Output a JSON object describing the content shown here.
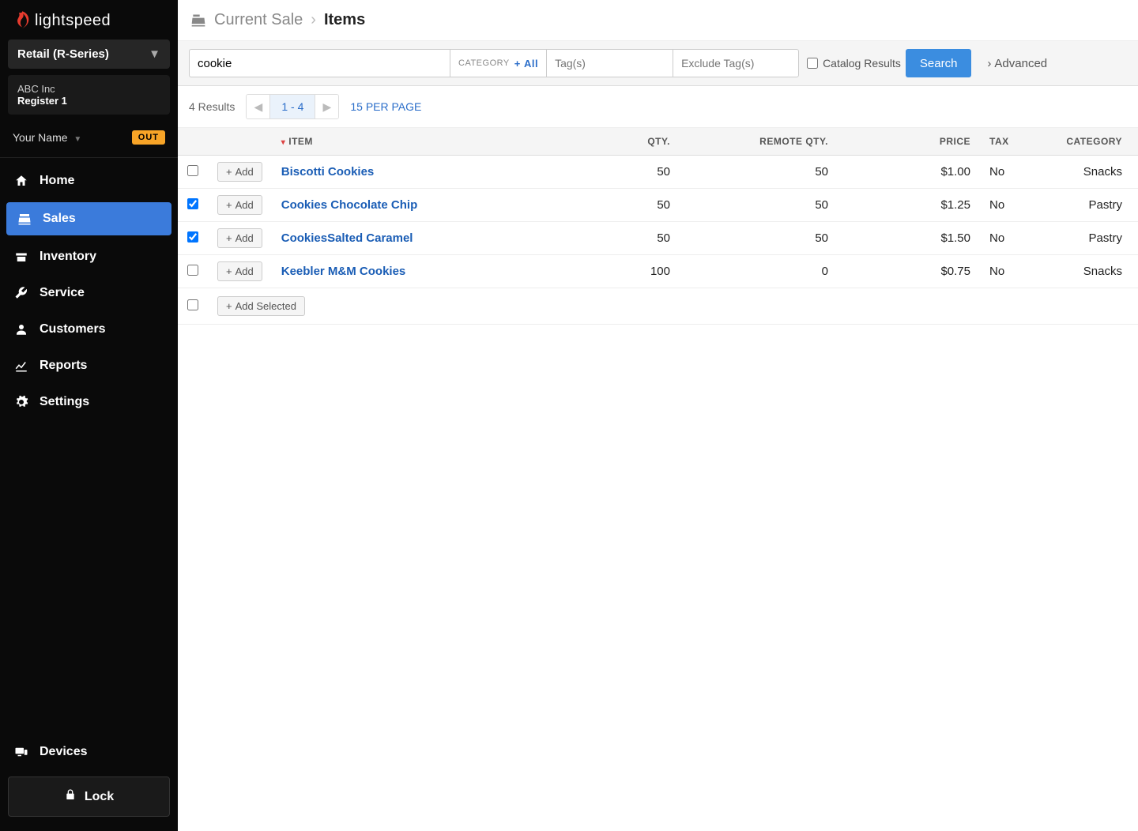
{
  "brand": "lightspeed",
  "retail_selector": "Retail (R-Series)",
  "store": {
    "company": "ABC Inc",
    "register": "Register 1"
  },
  "user": {
    "name": "Your Name",
    "out_badge": "OUT"
  },
  "nav": {
    "home": "Home",
    "sales": "Sales",
    "inventory": "Inventory",
    "service": "Service",
    "customers": "Customers",
    "reports": "Reports",
    "settings": "Settings",
    "devices": "Devices",
    "lock": "Lock"
  },
  "breadcrumb": {
    "parent": "Current Sale",
    "current": "Items"
  },
  "filter": {
    "search_value": "cookie",
    "category_label": "CATEGORY",
    "category_all": "All",
    "tags_placeholder": "Tag(s)",
    "exclude_placeholder": "Exclude Tag(s)",
    "catalog_label": "Catalog Results",
    "search_btn": "Search",
    "advanced": "Advanced"
  },
  "results": {
    "count_text": "4 Results",
    "range": "1 - 4",
    "per_page": "15 PER PAGE"
  },
  "table": {
    "headers": {
      "item": "ITEM",
      "qty": "QTY.",
      "remote": "REMOTE QTY.",
      "price": "PRICE",
      "tax": "TAX",
      "category": "CATEGORY"
    },
    "add_label": "Add",
    "add_selected": "Add Selected",
    "rows": [
      {
        "checked": false,
        "name": "Biscotti Cookies",
        "qty": "50",
        "remote": "50",
        "price": "$1.00",
        "tax": "No",
        "category": "Snacks"
      },
      {
        "checked": true,
        "name": "Cookies Chocolate Chip",
        "qty": "50",
        "remote": "50",
        "price": "$1.25",
        "tax": "No",
        "category": "Pastry"
      },
      {
        "checked": true,
        "name": "CookiesSalted Caramel",
        "qty": "50",
        "remote": "50",
        "price": "$1.50",
        "tax": "No",
        "category": "Pastry"
      },
      {
        "checked": false,
        "name": "Keebler M&M Cookies",
        "qty": "100",
        "remote": "0",
        "price": "$0.75",
        "tax": "No",
        "category": "Snacks"
      }
    ]
  }
}
